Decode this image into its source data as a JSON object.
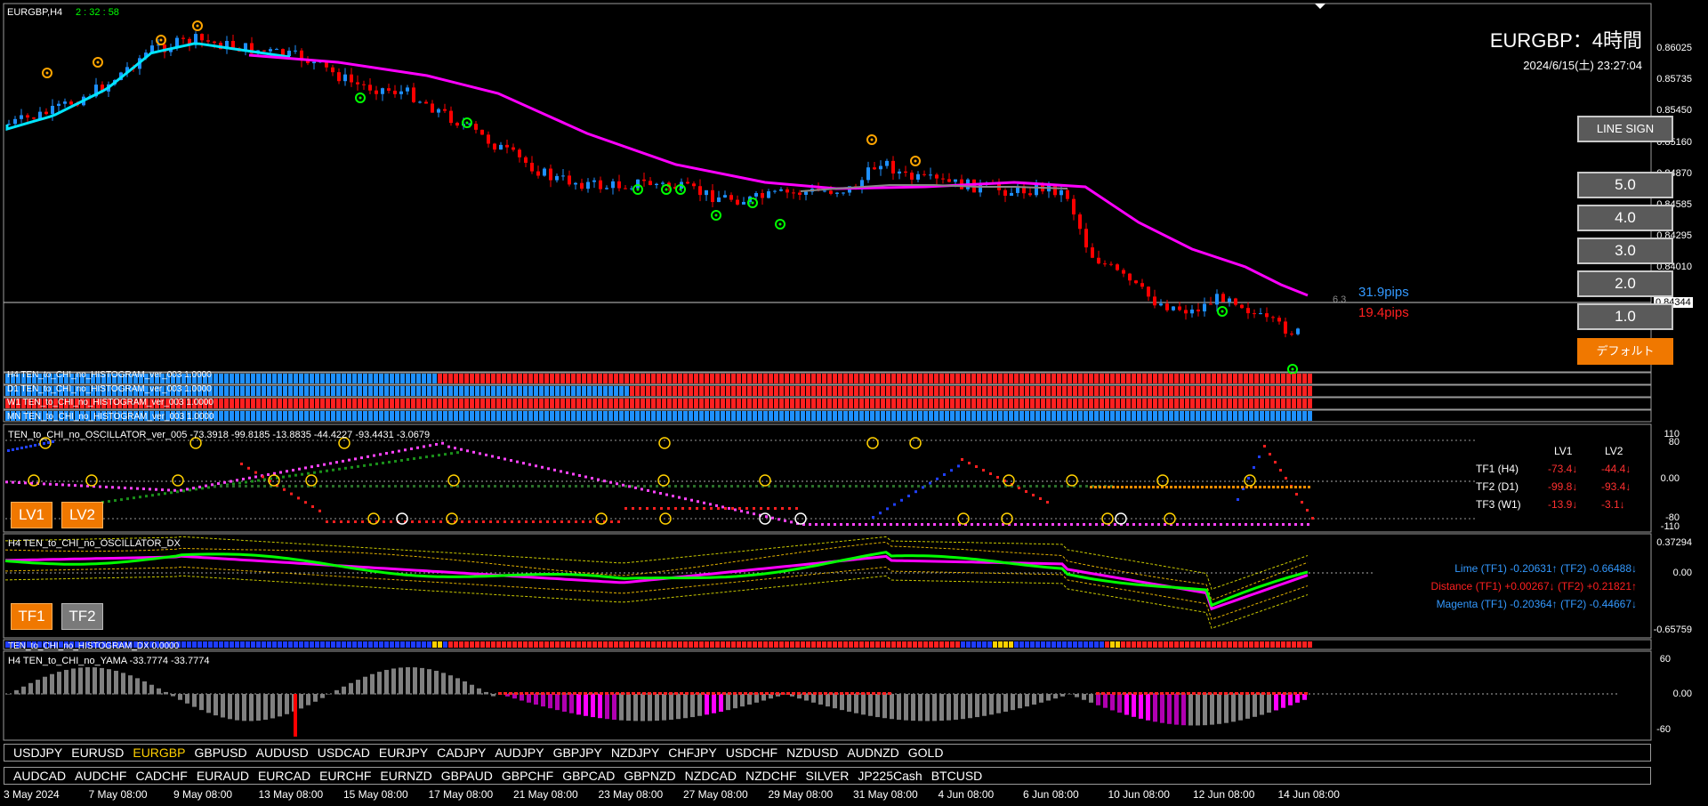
{
  "header": {
    "symbol_tf": "EURGBP,H4",
    "countdown": "2 : 32 : 58",
    "big_title": "EURGBP：4時間",
    "datetime": "2024/6/15(土) 23:27:04"
  },
  "price_axis": [
    "0.86025",
    "0.85735",
    "0.85450",
    "0.85160",
    "0.84870",
    "0.84585",
    "0.84295",
    "0.84010"
  ],
  "current_price": "0.84344",
  "pips": {
    "up": "31.9pips",
    "down": "19.4pips",
    "small": "6.3"
  },
  "buttons": {
    "line_sign": "LINE SIGN",
    "levels": [
      "5.0",
      "4.0",
      "3.0",
      "2.0",
      "1.0"
    ],
    "default": "デフォルト",
    "lv1": "LV1",
    "lv2": "LV2",
    "tf1": "TF1",
    "tf2": "TF2"
  },
  "histograms": [
    "H4 TEN_to_CHI_no_HISTOGRAM_ver_003 1.0000",
    "D1 TEN_to_CHI_no_HISTOGRAM_ver_003 1.0000",
    "W1 TEN_to_CHI_no_HISTOGRAM_ver_003 1.0000",
    "MN TEN_to_CHI_no_HISTOGRAM_ver_003 1.0000"
  ],
  "oscillator": {
    "label": "TEN_to_CHI_no_OSCILLATOR_ver_005 -73.3918 -99.8185 -13.8835 -44.4227 -93.4431 -3.0679",
    "axis": [
      "110",
      "80",
      "0.00",
      "-80",
      "-110"
    ],
    "table_header": [
      "LV1",
      "LV2"
    ],
    "rows": [
      {
        "name": "TF1 (H4)",
        "v1": "-73.4↓",
        "v2": "-44.4↓"
      },
      {
        "name": "TF2 (D1)",
        "v1": "-99.8↓",
        "v2": "-93.4↓"
      },
      {
        "name": "TF3 (W1)",
        "v1": "-13.9↓",
        "v2": "-3.1↓"
      }
    ]
  },
  "dx": {
    "label": "H4 TEN_to_CHI_no_OSCILLATOR_DX",
    "axis": [
      "0.37294",
      "0.00",
      "-0.65759"
    ],
    "lime": "Lime (TF1) -0.20631↑ (TF2) -0.66488↓",
    "distance": "Distance (TF1) +0.00267↓ (TF2) +0.21821↑",
    "magenta": "Magenta (TF1) -0.20364↑ (TF2) -0.44667↓"
  },
  "dx_hist_label": "TEN_to_CHI_no_HISTOGRAM_DX 0.0000",
  "yama": {
    "label": "H4 TEN_to_CHI_no_YAMA -33.7774 -33.7774",
    "axis": [
      "60",
      "0.00",
      "-60"
    ]
  },
  "symbols_row1": [
    "USDJPY",
    "EURUSD",
    "EURGBP",
    "GBPUSD",
    "AUDUSD",
    "USDCAD",
    "EURJPY",
    "CADJPY",
    "AUDJPY",
    "GBPJPY",
    "NZDJPY",
    "CHFJPY",
    "USDCHF",
    "NZDUSD",
    "AUDNZD",
    "GOLD"
  ],
  "active_symbol": "EURGBP",
  "symbols_row2": [
    "AUDCAD",
    "AUDCHF",
    "CADCHF",
    "EURAUD",
    "EURCAD",
    "EURCHF",
    "EURNZD",
    "GBPAUD",
    "GBPCHF",
    "GBPCAD",
    "GBPNZD",
    "NZDCAD",
    "NZDCHF",
    "SILVER",
    "JP225Cash",
    "BTCUSD"
  ],
  "date_axis": [
    "3 May 2024",
    "7 May 08:00",
    "9 May 08:00",
    "13 May 08:00",
    "15 May 08:00",
    "17 May 08:00",
    "21 May 08:00",
    "23 May 08:00",
    "27 May 08:00",
    "29 May 08:00",
    "31 May 08:00",
    "4 Jun 08:00",
    "6 Jun 08:00",
    "10 Jun 08:00",
    "12 Jun 08:00",
    "14 Jun 08:00"
  ],
  "colors": {
    "up": "#1e90ff",
    "down": "#ff0000",
    "magenta": "#ff00ff",
    "cyan": "#00e5ff",
    "lime": "#00ff00",
    "orange": "#f07800",
    "yellow": "#ffd000"
  }
}
